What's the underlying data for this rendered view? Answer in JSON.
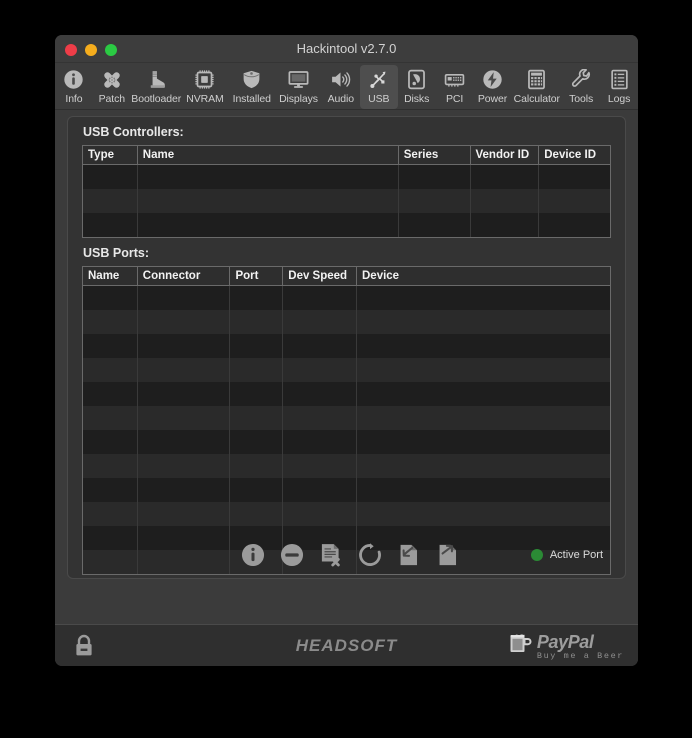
{
  "window": {
    "title": "Hackintool v2.7.0",
    "traffic_lights": [
      {
        "name": "close",
        "color": "#ee3d48"
      },
      {
        "name": "minimize",
        "color": "#f5ad1d"
      },
      {
        "name": "maximize",
        "color": "#2bca43"
      }
    ]
  },
  "toolbar": {
    "selected": "USB",
    "items": [
      {
        "label": "Info",
        "icon": "info-icon"
      },
      {
        "label": "Patch",
        "icon": "bandage-icon"
      },
      {
        "label": "Bootloader",
        "icon": "boot-icon"
      },
      {
        "label": "NVRAM",
        "icon": "chip-icon"
      },
      {
        "label": "Installed",
        "icon": "shield-icon"
      },
      {
        "label": "Displays",
        "icon": "monitor-icon"
      },
      {
        "label": "Audio",
        "icon": "speaker-icon"
      },
      {
        "label": "USB",
        "icon": "usb-icon"
      },
      {
        "label": "Disks",
        "icon": "harddrive-icon"
      },
      {
        "label": "PCI",
        "icon": "pcicard-icon"
      },
      {
        "label": "Power",
        "icon": "bolt-icon"
      },
      {
        "label": "Calculator",
        "icon": "calculator-icon"
      },
      {
        "label": "Tools",
        "icon": "wrench-icon"
      },
      {
        "label": "Logs",
        "icon": "list-icon"
      }
    ]
  },
  "controllers": {
    "title": "USB Controllers:",
    "columns": [
      "Type",
      "Name",
      "Series",
      "Vendor ID",
      "Device ID"
    ],
    "rows": [
      [
        "",
        "",
        "",
        "",
        ""
      ],
      [
        "",
        "",
        "",
        "",
        ""
      ],
      [
        "",
        "",
        "",
        "",
        ""
      ]
    ]
  },
  "ports": {
    "title": "USB Ports:",
    "columns": [
      "Name",
      "Connector",
      "Port",
      "Dev Speed",
      "Device"
    ],
    "rows": [
      [
        "",
        "",
        "",
        "",
        ""
      ],
      [
        "",
        "",
        "",
        "",
        ""
      ],
      [
        "",
        "",
        "",
        "",
        ""
      ],
      [
        "",
        "",
        "",
        "",
        ""
      ],
      [
        "",
        "",
        "",
        "",
        ""
      ],
      [
        "",
        "",
        "",
        "",
        ""
      ],
      [
        "",
        "",
        "",
        "",
        ""
      ],
      [
        "",
        "",
        "",
        "",
        ""
      ],
      [
        "",
        "",
        "",
        "",
        ""
      ],
      [
        "",
        "",
        "",
        "",
        ""
      ],
      [
        "",
        "",
        "",
        "",
        ""
      ],
      [
        "",
        "",
        "",
        "",
        ""
      ]
    ]
  },
  "actions": {
    "buttons": [
      {
        "name": "info-button",
        "icon": "info-circle-icon"
      },
      {
        "name": "remove-button",
        "icon": "minus-circle-icon"
      },
      {
        "name": "delete-button",
        "icon": "document-delete-icon"
      },
      {
        "name": "refresh-button",
        "icon": "refresh-icon"
      },
      {
        "name": "import-button",
        "icon": "import-icon"
      },
      {
        "name": "export-button",
        "icon": "export-icon"
      }
    ],
    "legend": {
      "label": "Active Port",
      "color": "#2b8a35"
    }
  },
  "footer": {
    "lock_icon": "lock-icon",
    "brand": "HEADSOFT",
    "paypal": {
      "logo": "PayPal",
      "subtitle": "Buy me a Beer",
      "icon": "beer-mug-icon"
    }
  }
}
